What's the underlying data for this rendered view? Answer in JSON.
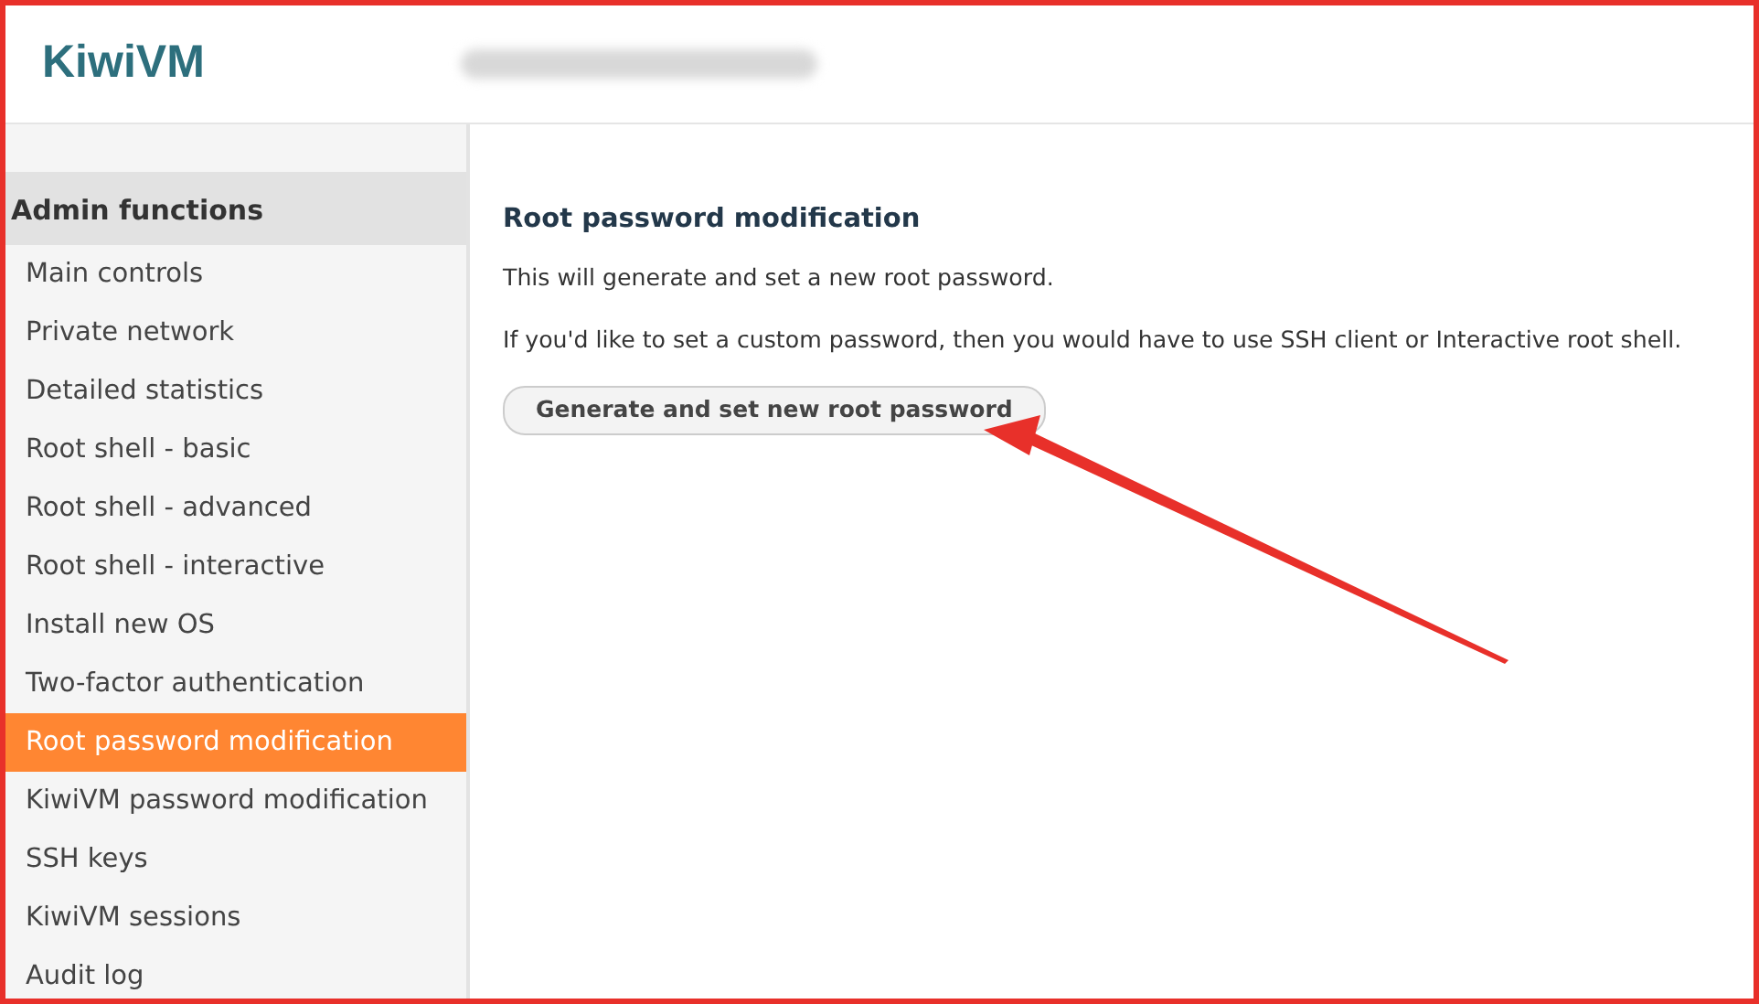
{
  "header": {
    "logo": "KiwiVM"
  },
  "sidebar": {
    "heading": "Admin functions",
    "items": [
      {
        "label": "Main controls",
        "selected": false
      },
      {
        "label": "Private network",
        "selected": false
      },
      {
        "label": "Detailed statistics",
        "selected": false
      },
      {
        "label": "Root shell - basic",
        "selected": false
      },
      {
        "label": "Root shell - advanced",
        "selected": false
      },
      {
        "label": "Root shell - interactive",
        "selected": false
      },
      {
        "label": "Install new OS",
        "selected": false
      },
      {
        "label": "Two-factor authentication",
        "selected": false
      },
      {
        "label": "Root password modification",
        "selected": true
      },
      {
        "label": "KiwiVM password modification",
        "selected": false
      },
      {
        "label": "SSH keys",
        "selected": false
      },
      {
        "label": "KiwiVM sessions",
        "selected": false
      },
      {
        "label": "Audit log",
        "selected": false
      }
    ]
  },
  "main": {
    "title": "Root password modification",
    "paragraphs": [
      "This will generate and set a new root password.",
      "If you'd like to set a custom password, then you would have to use SSH client or Interactive root shell."
    ],
    "button": "Generate and set new root password"
  }
}
